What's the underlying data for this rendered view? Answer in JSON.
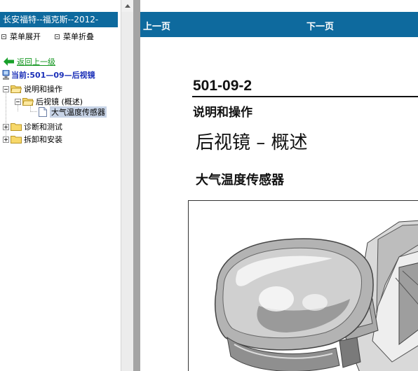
{
  "sidebar": {
    "title": "长安福特--福克斯--2012-",
    "expand_all": "菜单展开",
    "collapse_all": "菜单折叠",
    "back": "返回上一级",
    "current": "当前:501—09—后视镜",
    "tree": [
      {
        "label": "说明和操作",
        "state": "expanded"
      },
      {
        "label": "后视镜 (概述)",
        "state": "expanded"
      },
      {
        "label": "大气温度传感器",
        "state": "selected"
      },
      {
        "label": "诊断和测试",
        "state": "collapsed"
      },
      {
        "label": "拆卸和安装",
        "state": "collapsed"
      }
    ]
  },
  "toolbar": {
    "prev": "上一页",
    "next": "下一页"
  },
  "document": {
    "number": "501-09-2",
    "section": "说明和操作",
    "heading": "后视镜 – 概述",
    "subheading": "大气温度传感器"
  },
  "colors": {
    "header_blue": "#0e6a9e",
    "link_green": "#12961e",
    "current_blue": "#1a2fb8",
    "selection": "#c7d3e6"
  }
}
